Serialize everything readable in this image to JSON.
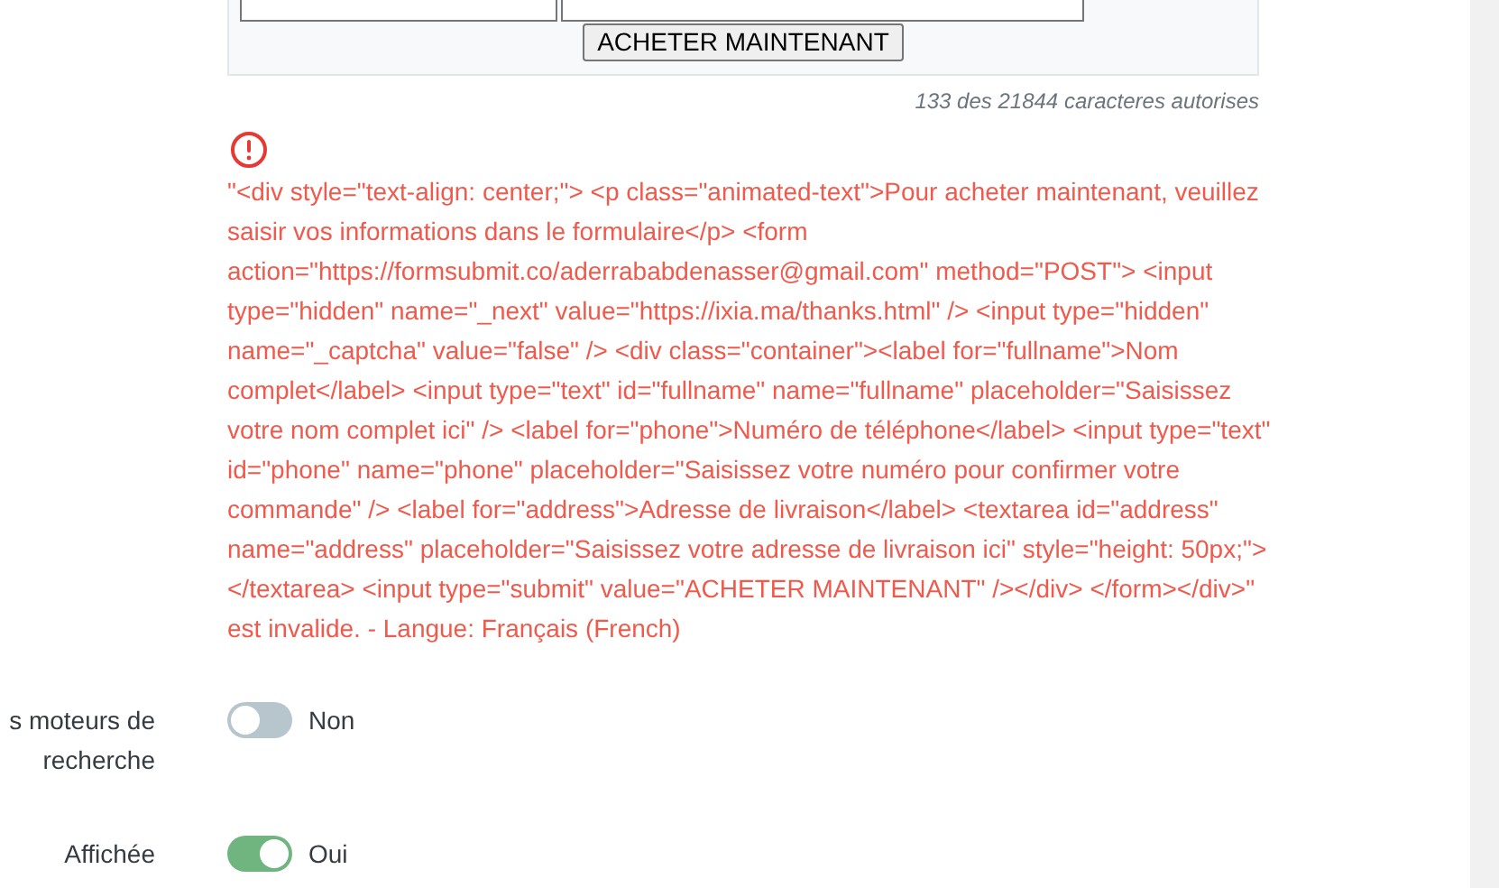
{
  "preview": {
    "button": "ACHETER MAINTENANT"
  },
  "char_count": "133 des 21844 caracteres autorises",
  "error": {
    "message": "\"<div style=\"text-align: center;\"> <p class=\"animated-text\">Pour acheter maintenant, veuillez saisir vos informations dans le formulaire</p> <form action=\"https://formsubmit.co/aderrababdenasser@gmail.com\" method=\"POST\"> <input type=\"hidden\" name=\"_next\" value=\"https://ixia.ma/thanks.html\" /> <input type=\"hidden\" name=\"_captcha\" value=\"false\" /> <div class=\"container\"><label for=\"fullname\">Nom complet</label> <input type=\"text\" id=\"fullname\" name=\"fullname\" placeholder=\"Saisissez votre nom complet ici\" /> <label for=\"phone\">Numéro de téléphone</label> <input type=\"text\" id=\"phone\" name=\"phone\" placeholder=\"Saisissez votre numéro pour confirmer votre commande\" /> <label for=\"address\">Adresse de livraison</label> <textarea id=\"address\" name=\"address\" placeholder=\"Saisissez votre adresse de livraison ici\" style=\"height: 50px;\"></textarea> <input type=\"submit\" value=\"ACHETER MAINTENANT\" /></div> </form></div>\" est invalide. - Langue: Français (French)"
  },
  "settings": [
    {
      "label": "s moteurs de recherche",
      "on": false,
      "value": "Non"
    },
    {
      "label": "Affichée",
      "on": true,
      "value": "Oui"
    }
  ]
}
